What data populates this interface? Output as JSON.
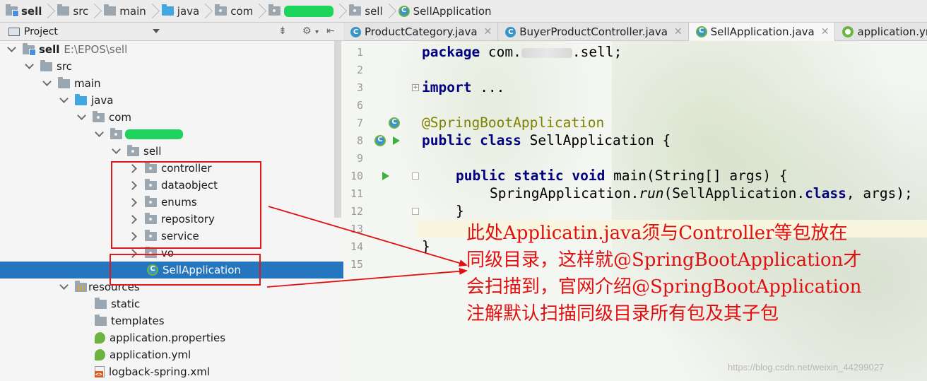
{
  "breadcrumb": {
    "items": [
      {
        "label": "sell",
        "icon": "module-folder-icon",
        "bold": true
      },
      {
        "label": "src",
        "icon": "folder-icon"
      },
      {
        "label": "main",
        "icon": "folder-icon"
      },
      {
        "label": "java",
        "icon": "source-folder-icon"
      },
      {
        "label": "com",
        "icon": "package-folder-icon"
      },
      {
        "label": "",
        "icon": "package-folder-icon",
        "redacted": true
      },
      {
        "label": "sell",
        "icon": "package-folder-icon"
      },
      {
        "label": "SellApplication",
        "icon": "spring-class-icon"
      }
    ]
  },
  "project_panel": {
    "title": "Project",
    "tree": [
      {
        "label": "sell",
        "path": "E:\\EPOS\\sell",
        "bold": true,
        "twisty": "open"
      },
      {
        "label": "src",
        "twisty": "open"
      },
      {
        "label": "main",
        "twisty": "open"
      },
      {
        "label": "java",
        "twisty": "open"
      },
      {
        "label": "com",
        "twisty": "open"
      },
      {
        "label": "",
        "twisty": "open",
        "redacted": true
      },
      {
        "label": "sell",
        "twisty": "open"
      },
      {
        "label": "controller",
        "twisty": "closed"
      },
      {
        "label": "dataobject",
        "twisty": "closed"
      },
      {
        "label": "enums",
        "twisty": "closed"
      },
      {
        "label": "repository",
        "twisty": "closed"
      },
      {
        "label": "service",
        "twisty": "closed"
      },
      {
        "label": "vo",
        "twisty": "closed"
      },
      {
        "label": "SellApplication",
        "twisty": "none",
        "selected": true
      },
      {
        "label": "resources",
        "twisty": "open"
      },
      {
        "label": "static",
        "twisty": "none"
      },
      {
        "label": "templates",
        "twisty": "none"
      },
      {
        "label": "application.properties",
        "twisty": "none"
      },
      {
        "label": "application.yml",
        "twisty": "none"
      },
      {
        "label": "logback-spring.xml",
        "twisty": "none"
      }
    ]
  },
  "tabs": [
    {
      "label": "ProductCategory.java",
      "icon": "class-icon"
    },
    {
      "label": "BuyerProductController.java",
      "icon": "class-icon"
    },
    {
      "label": "SellApplication.java",
      "icon": "spring-class-icon",
      "active": true
    },
    {
      "label": "application.yml",
      "icon": "spring-icon"
    }
  ],
  "editor": {
    "line_numbers": [
      "1",
      "2",
      "3",
      "6",
      "7",
      "8",
      "9",
      "10",
      "11",
      "12",
      "13",
      "14",
      "15"
    ],
    "code": {
      "l1_kw": "package",
      "l1_a": " com.",
      "l1_b": ".sell;",
      "l3_kw": "import",
      "l3_rest": " ...",
      "l7": "@SpringBootApplication",
      "l8_kw": "public class",
      "l8_rest": " SellApplication {",
      "l10_kw": "public static void",
      "l10_rest": " main(String[] args) {",
      "l11_a": "SpringApplication.",
      "l11_b": "run",
      "l11_c": "(SellApplication.",
      "l11_d": "class",
      "l11_e": ", args);",
      "l12": "}",
      "l14": "}"
    }
  },
  "annotation": {
    "lines": [
      "此处Applicatin.java须与Controller等包放在",
      "同级目录，这样就@SpringBootApplication才",
      "会扫描到，官网介绍@SpringBootApplication",
      "注解默认扫描同级目录所有包及其子包"
    ],
    "color": "#e01010"
  },
  "watermark": "https://blog.csdn.net/weixin_44299027"
}
